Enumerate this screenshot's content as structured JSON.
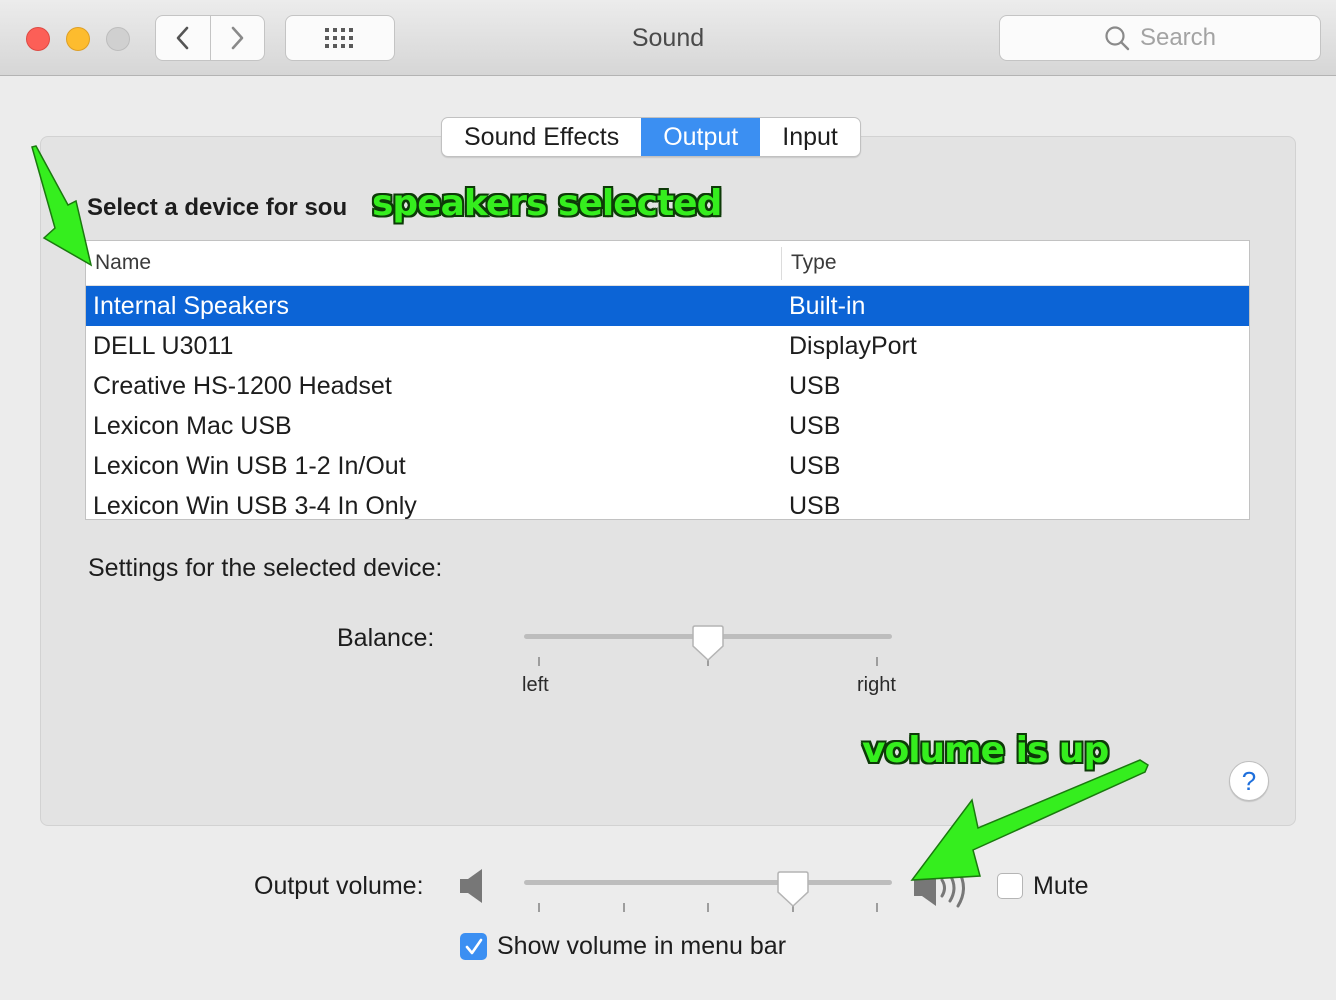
{
  "window": {
    "title": "Sound",
    "search_placeholder": "Search"
  },
  "tabs": [
    {
      "label": "Sound Effects",
      "active": false
    },
    {
      "label": "Output",
      "active": true
    },
    {
      "label": "Input",
      "active": false
    }
  ],
  "device_select": {
    "label": "Select a device for sou",
    "columns": {
      "name": "Name",
      "type": "Type"
    },
    "rows": [
      {
        "name": "Internal Speakers",
        "type": "Built-in",
        "selected": true
      },
      {
        "name": "DELL U3011",
        "type": "DisplayPort",
        "selected": false
      },
      {
        "name": "Creative HS-1200 Headset",
        "type": "USB",
        "selected": false
      },
      {
        "name": "Lexicon Mac USB",
        "type": "USB",
        "selected": false
      },
      {
        "name": "Lexicon Win USB 1-2 In/Out",
        "type": "USB",
        "selected": false
      },
      {
        "name": "Lexicon Win USB 3-4 In Only",
        "type": "USB",
        "selected": false
      }
    ]
  },
  "settings": {
    "label": "Settings for the selected device:",
    "balance": {
      "label": "Balance:",
      "left_label": "left",
      "right_label": "right",
      "value": 0.5
    }
  },
  "help": {
    "label": "?"
  },
  "output_volume": {
    "label": "Output volume:",
    "value": 0.75,
    "mute_label": "Mute",
    "muted": false,
    "show_in_menu_bar_label": "Show volume in menu bar",
    "show_in_menu_bar": true
  },
  "annotations": {
    "speakers": "speakers selected",
    "volume": "volume is up"
  },
  "colors": {
    "accent": "#3b8ff2",
    "selection": "#0c64d6",
    "annotation_green": "#35ee1e"
  }
}
